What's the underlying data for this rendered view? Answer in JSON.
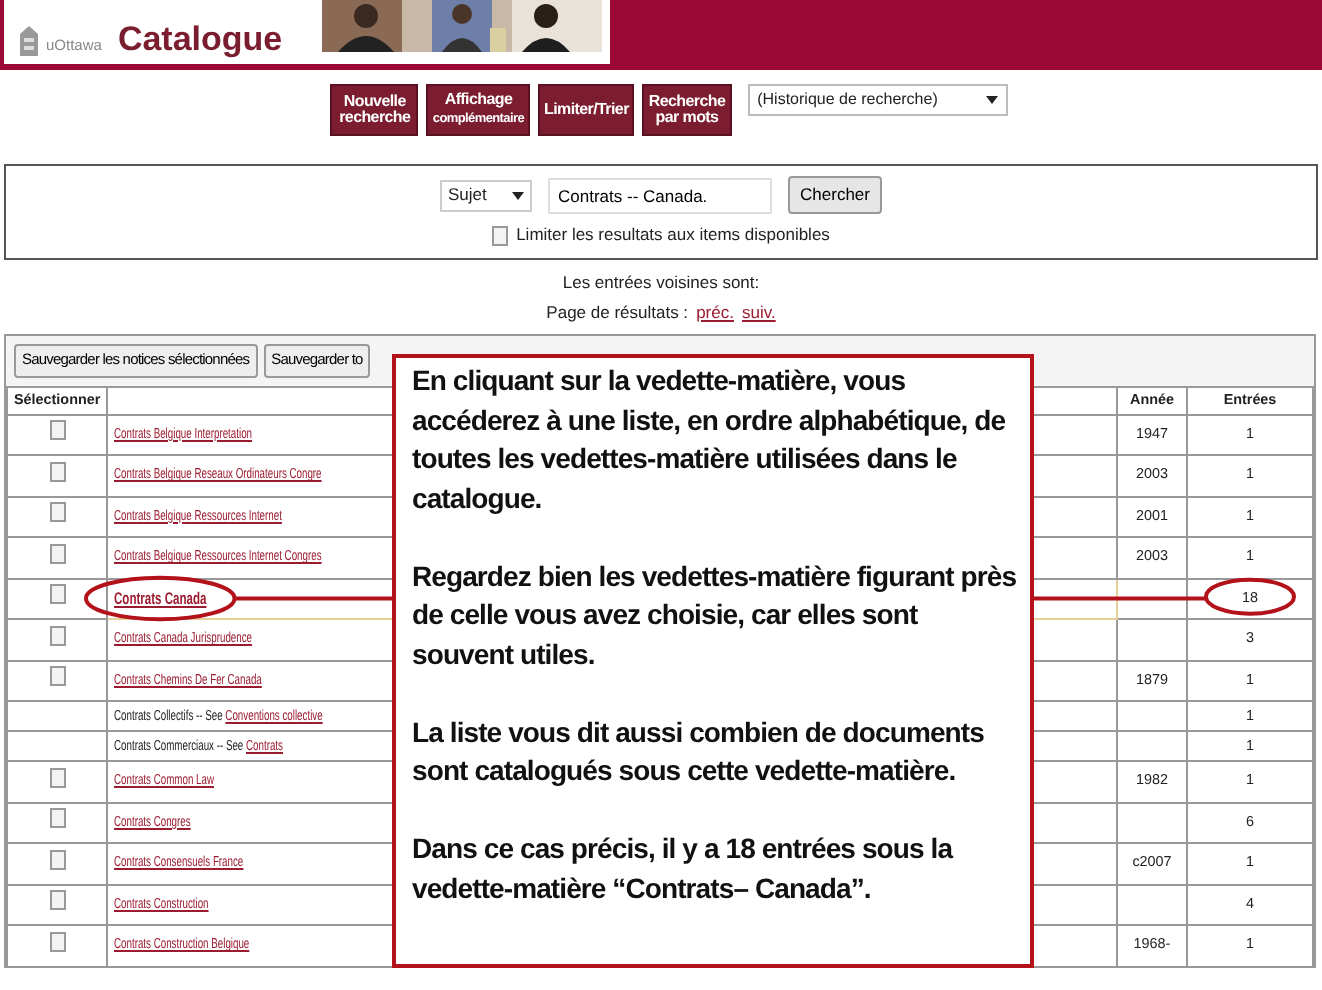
{
  "header": {
    "logo_text": "uOttawa",
    "title": "Catalogue"
  },
  "toolbar": {
    "buttons": [
      {
        "lines": [
          "Nouvelle",
          "recherche"
        ]
      },
      {
        "lines": [
          "Affichage",
          "complémentaire"
        ]
      },
      {
        "lines": [
          "Limiter/Trier"
        ]
      },
      {
        "lines": [
          "Recherche",
          "par mots"
        ]
      }
    ],
    "history_select": "(Historique de recherche)"
  },
  "search": {
    "field_type": "Sujet",
    "query": "Contrats -- Canada.",
    "button": "Chercher",
    "limit_checkbox": {
      "label": "Limiter les resultats aux items disponibles",
      "checked": false
    }
  },
  "neighbors_label": "Les entrées voisines sont:",
  "pagination": {
    "label": "Page de résultats :",
    "links": [
      "préc.",
      "suiv."
    ]
  },
  "save_buttons": [
    "Sauvegarder les notices sélectionnées",
    "Sauvegarder to"
  ],
  "table": {
    "columns": [
      "Sélectionner",
      "Année",
      "Entrées"
    ],
    "rows": [
      {
        "kind": "entry",
        "subject": "Contrats Belgique Interpretation",
        "year": "1947",
        "entries": "1",
        "checked": false,
        "highlighted": false
      },
      {
        "kind": "entry",
        "subject": "Contrats Belgique Reseaux Ordinateurs Congre",
        "year": "2003",
        "entries": "1",
        "checked": false,
        "highlighted": false
      },
      {
        "kind": "entry",
        "subject": "Contrats Belgique Ressources Internet",
        "year": "2001",
        "entries": "1",
        "checked": false,
        "highlighted": false
      },
      {
        "kind": "entry",
        "subject": "Contrats Belgique Ressources Internet Congres",
        "year": "2003",
        "entries": "1",
        "checked": false,
        "highlighted": false
      },
      {
        "kind": "entry",
        "subject": "Contrats Canada",
        "year": "",
        "entries": "18",
        "checked": false,
        "highlighted": true
      },
      {
        "kind": "entry",
        "subject": "Contrats Canada Jurisprudence",
        "year": "",
        "entries": "3",
        "checked": false,
        "highlighted": false
      },
      {
        "kind": "entry",
        "subject": "Contrats Chemins De Fer Canada",
        "year": "1879",
        "entries": "1",
        "checked": false,
        "highlighted": false
      },
      {
        "kind": "see",
        "text": "Contrats Collectifs -- See",
        "link": "Conventions collective",
        "entries": "1"
      },
      {
        "kind": "see",
        "text": "Contrats Commerciaux -- See",
        "link": "Contrats",
        "entries": "1"
      },
      {
        "kind": "entry",
        "subject": "Contrats Common Law",
        "year": "1982",
        "entries": "1",
        "checked": false,
        "highlighted": false
      },
      {
        "kind": "entry",
        "subject": "Contrats Congres",
        "year": "",
        "entries": "6",
        "checked": false,
        "highlighted": false
      },
      {
        "kind": "entry",
        "subject": "Contrats Consensuels France",
        "year": "c2007",
        "entries": "1",
        "checked": false,
        "highlighted": false
      },
      {
        "kind": "entry",
        "subject": "Contrats Construction",
        "year": "",
        "entries": "4",
        "checked": false,
        "highlighted": false
      },
      {
        "kind": "entry",
        "subject": "Contrats Construction Belgique",
        "year": "1968-",
        "entries": "1",
        "checked": false,
        "highlighted": false
      }
    ]
  },
  "callout": {
    "paragraphs": [
      "En cliquant sur la **vedette-matière**, vous accéderez à une liste, en ordre alphabétique, de toutes les vedettes-matière utilisées dans le catalogue.",
      "Regardez bien les vedettes-matière figurant près de celle vous avez choisie, car elles sont souvent utiles.",
      "La liste vous dit aussi combien de documents sont catalogués sous cette vedette-matière.",
      "Dans ce cas précis, il y a 18 entrées sous la vedette-matière “Contrats– Canada”."
    ]
  }
}
